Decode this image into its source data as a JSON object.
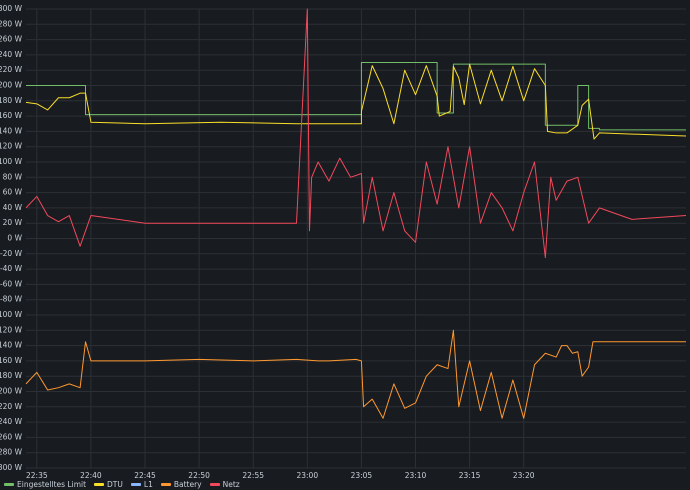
{
  "chart_data": {
    "type": "line",
    "ylim": [
      -300,
      300
    ],
    "y_unit": "W",
    "y_ticks": [
      "300 W",
      "280 W",
      "260 W",
      "240 W",
      "220 W",
      "200 W",
      "180 W",
      "160 W",
      "140 W",
      "120 W",
      "100 W",
      "80 W",
      "60 W",
      "40 W",
      "20 W",
      "0 W",
      "-20 W",
      "-40 W",
      "-60 W",
      "-80 W",
      "-100 W",
      "-120 W",
      "-140 W",
      "-160 W",
      "-180 W",
      "-200 W",
      "-220 W",
      "-240 W",
      "-260 W",
      "-280 W",
      "-300 W"
    ],
    "x_ticks": [
      "22:35",
      "22:40",
      "22:45",
      "22:50",
      "22:55",
      "23:00",
      "23:05",
      "23:10",
      "23:15",
      "23:20"
    ],
    "x_range_minutes": [
      -1,
      60
    ],
    "grid": true,
    "legend_position": "bottom-left",
    "series": [
      {
        "name": "Eingestelltes Limit",
        "color": "#73bf69",
        "points": [
          [
            -1,
            200
          ],
          [
            4.5,
            200
          ],
          [
            4.5,
            162
          ],
          [
            10,
            162
          ],
          [
            17,
            162
          ],
          [
            24,
            162
          ],
          [
            30,
            162
          ],
          [
            30,
            230
          ],
          [
            37,
            230
          ],
          [
            37,
            164
          ],
          [
            38.5,
            164
          ],
          [
            38.5,
            228
          ],
          [
            47,
            228
          ],
          [
            47,
            200
          ],
          [
            47,
            148
          ],
          [
            50,
            148
          ],
          [
            50,
            200
          ],
          [
            51,
            200
          ],
          [
            51,
            144
          ],
          [
            52,
            144
          ],
          [
            52,
            142
          ],
          [
            60,
            142
          ]
        ]
      },
      {
        "name": "DTU",
        "color": "#fade2a",
        "points": [
          [
            -1,
            178
          ],
          [
            0,
            176
          ],
          [
            1,
            168
          ],
          [
            2,
            184
          ],
          [
            3,
            184
          ],
          [
            4,
            190
          ],
          [
            4.5,
            190
          ],
          [
            5,
            152
          ],
          [
            10,
            150
          ],
          [
            17,
            152
          ],
          [
            24,
            150
          ],
          [
            30,
            150
          ],
          [
            30,
            166
          ],
          [
            31,
            226
          ],
          [
            32,
            196
          ],
          [
            33,
            150
          ],
          [
            34,
            220
          ],
          [
            35,
            188
          ],
          [
            36,
            226
          ],
          [
            37,
            186
          ],
          [
            37.2,
            160
          ],
          [
            38.2,
            166
          ],
          [
            38.5,
            225
          ],
          [
            39,
            210
          ],
          [
            39.5,
            175
          ],
          [
            40,
            228
          ],
          [
            41,
            176
          ],
          [
            42,
            220
          ],
          [
            43,
            180
          ],
          [
            44,
            225
          ],
          [
            45,
            180
          ],
          [
            46,
            222
          ],
          [
            47,
            200
          ],
          [
            47.2,
            140
          ],
          [
            48,
            138
          ],
          [
            49,
            138
          ],
          [
            50,
            148
          ],
          [
            50.4,
            174
          ],
          [
            51,
            182
          ],
          [
            51.5,
            130
          ],
          [
            52,
            138
          ],
          [
            60,
            134
          ]
        ]
      },
      {
        "name": "L1",
        "color": "#8ab8ff",
        "points": []
      },
      {
        "name": "Battery",
        "color": "#ff9830",
        "points": [
          [
            -1,
            -190
          ],
          [
            0,
            -175
          ],
          [
            1,
            -198
          ],
          [
            2,
            -195
          ],
          [
            3,
            -190
          ],
          [
            4,
            -195
          ],
          [
            4.5,
            -135
          ],
          [
            5,
            -160
          ],
          [
            10,
            -160
          ],
          [
            15,
            -158
          ],
          [
            20,
            -160
          ],
          [
            24,
            -158
          ],
          [
            26,
            -160
          ],
          [
            27,
            -160
          ],
          [
            29.5,
            -158
          ],
          [
            30,
            -160
          ],
          [
            30.2,
            -220
          ],
          [
            31,
            -210
          ],
          [
            32,
            -235
          ],
          [
            33,
            -190
          ],
          [
            34,
            -222
          ],
          [
            35,
            -215
          ],
          [
            36,
            -180
          ],
          [
            37,
            -165
          ],
          [
            38,
            -170
          ],
          [
            38.5,
            -120
          ],
          [
            39,
            -220
          ],
          [
            40,
            -160
          ],
          [
            41,
            -225
          ],
          [
            42,
            -175
          ],
          [
            43,
            -235
          ],
          [
            44,
            -185
          ],
          [
            45,
            -235
          ],
          [
            46,
            -165
          ],
          [
            47,
            -150
          ],
          [
            48,
            -155
          ],
          [
            48.5,
            -140
          ],
          [
            49,
            -140
          ],
          [
            49.5,
            -150
          ],
          [
            50,
            -148
          ],
          [
            50.4,
            -180
          ],
          [
            51,
            -168
          ],
          [
            51.4,
            -135
          ],
          [
            52,
            -135
          ],
          [
            60,
            -135
          ]
        ]
      },
      {
        "name": "Netz",
        "color": "#f2495c",
        "points": [
          [
            -1,
            40
          ],
          [
            0,
            55
          ],
          [
            1,
            30
          ],
          [
            2,
            22
          ],
          [
            3,
            30
          ],
          [
            4,
            -10
          ],
          [
            5,
            30
          ],
          [
            10,
            20
          ],
          [
            15,
            20
          ],
          [
            20,
            20
          ],
          [
            24,
            20
          ],
          [
            25,
            300
          ],
          [
            25.2,
            10
          ],
          [
            25.4,
            80
          ],
          [
            26,
            100
          ],
          [
            27,
            75
          ],
          [
            28,
            105
          ],
          [
            29,
            80
          ],
          [
            30,
            85
          ],
          [
            30.2,
            20
          ],
          [
            31,
            80
          ],
          [
            32,
            10
          ],
          [
            33,
            60
          ],
          [
            34,
            10
          ],
          [
            35,
            -5
          ],
          [
            36,
            100
          ],
          [
            37,
            45
          ],
          [
            38,
            120
          ],
          [
            39,
            40
          ],
          [
            40,
            120
          ],
          [
            41,
            20
          ],
          [
            42,
            60
          ],
          [
            43,
            40
          ],
          [
            44,
            10
          ],
          [
            45,
            60
          ],
          [
            46,
            100
          ],
          [
            47,
            -25
          ],
          [
            47.5,
            80
          ],
          [
            48,
            50
          ],
          [
            49,
            75
          ],
          [
            50,
            80
          ],
          [
            51,
            20
          ],
          [
            52,
            40
          ],
          [
            55,
            25
          ],
          [
            60,
            30
          ]
        ]
      }
    ]
  }
}
